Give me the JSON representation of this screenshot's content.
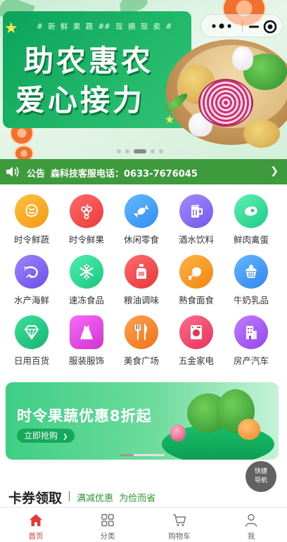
{
  "banner": {
    "tag_left": "# 新 鲜 果 蔬 #",
    "tag_right": "# 现 摘 现 卖 #",
    "title_line1": "助农惠农",
    "title_line2": "爱心接力",
    "slides": 5,
    "active_slide": 3
  },
  "capsule": {
    "more_icon": "more-dots-icon",
    "close_icon": "close-target-icon"
  },
  "notice": {
    "label": "公告",
    "text": "森科技客服电话：0633-7676045",
    "icon": "speaker-icon"
  },
  "categories": [
    {
      "label": "时令鲜蔬",
      "icon": "vegetable-icon",
      "color": "#f7a51c"
    },
    {
      "label": "时令鲜果",
      "icon": "grape-icon",
      "color": "#f04a4a"
    },
    {
      "label": "休闲零食",
      "icon": "candy-icon",
      "color": "#3fa0f5"
    },
    {
      "label": "酒水饮料",
      "icon": "beer-icon",
      "color": "#8a6cf0"
    },
    {
      "label": "鲜肉禽蛋",
      "icon": "meat-icon",
      "color": "#2ed59a"
    },
    {
      "label": "水产海鲜",
      "icon": "shrimp-icon",
      "color": "#7b63ee"
    },
    {
      "label": "速冻食品",
      "icon": "snowflake-icon",
      "color": "#25d58f"
    },
    {
      "label": "粮油调味",
      "icon": "oil-bottle-icon",
      "color": "#f0474a"
    },
    {
      "label": "熟食面食",
      "icon": "roast-chicken-icon",
      "color": "#f79a1f"
    },
    {
      "label": "牛奶乳品",
      "icon": "cupcake-icon",
      "color": "#3f95f5"
    },
    {
      "label": "日用百货",
      "icon": "diamond-icon",
      "color": "#23c77f"
    },
    {
      "label": "服装服饰",
      "icon": "dress-icon",
      "color": "#e94ae8"
    },
    {
      "label": "美食广场",
      "icon": "cutlery-icon",
      "color": "#f7862a"
    },
    {
      "label": "五金家电",
      "icon": "washing-machine-icon",
      "color": "#f0476c"
    },
    {
      "label": "房产汽车",
      "icon": "building-icon",
      "color": "#a65ef0"
    }
  ],
  "promo": {
    "title": "时令果蔬优惠8折起",
    "button": "立即抢购",
    "button_arrow": "❯"
  },
  "fab": {
    "line1": "快捷",
    "line2": "导航"
  },
  "coupon": {
    "title": "卡券领取",
    "subtitle": "满减优惠  为俭而省"
  },
  "tabbar": [
    {
      "label": "首页",
      "icon": "home-icon",
      "active": true
    },
    {
      "label": "分类",
      "icon": "category-grid-icon",
      "active": false
    },
    {
      "label": "购物车",
      "icon": "cart-icon",
      "active": false
    },
    {
      "label": "我",
      "icon": "user-icon",
      "active": false
    }
  ],
  "colors": {
    "brand_green": "#3d9a3d",
    "banner_green": "#12a85e",
    "active_red": "#e53935"
  }
}
